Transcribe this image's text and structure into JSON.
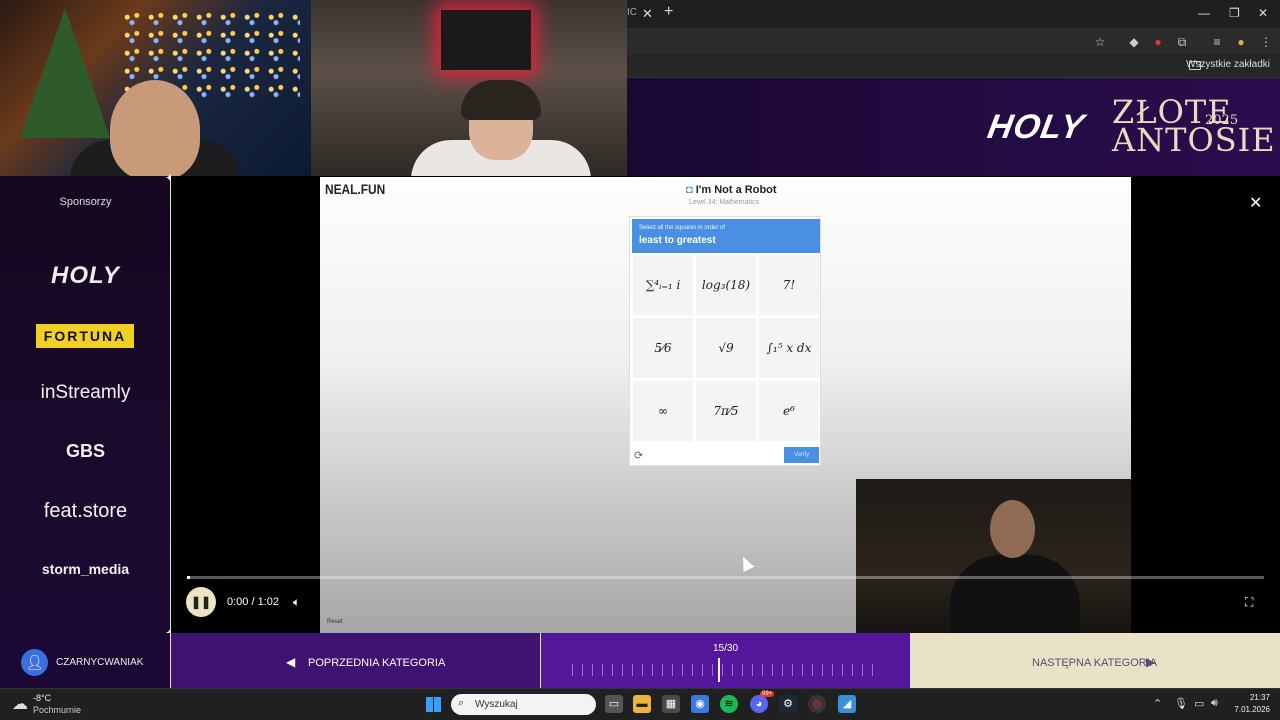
{
  "browser": {
    "tab_fragment": "IC",
    "bookmarks_all": "Wszystkie zakładki"
  },
  "banner": {
    "brand": "HOLY",
    "event_line1": "ZŁOTE",
    "event_line2": "ANTOSIE",
    "year": "2025"
  },
  "sidebar": {
    "title": "Sponsorzy",
    "sponsors": [
      "HOLY",
      "FORTUNA",
      "inStreamly",
      "GBS",
      "feat.store",
      "storm_media"
    ]
  },
  "game": {
    "site": "NEAL.FUN",
    "title": "I'm Not a Robot",
    "level": "Level 34: Mathematics",
    "instruction_small": "Select all the squares in order of",
    "instruction_big": "least to greatest",
    "cells": [
      "∑⁴ᵢ₌₁ i",
      "log₃(18)",
      "7!",
      "5⁄6",
      "√9",
      "∫₁⁵ x dx",
      "∞",
      "7π⁄5",
      "e⁶"
    ],
    "verify": "Verify",
    "reset": "Reset"
  },
  "player": {
    "time": "0:00 / 1:02",
    "progress": 0.002
  },
  "bottom": {
    "username": "CZARNYCWANIAK",
    "prev": "POPRZEDNIA KATEGORIA",
    "counter": "15/30",
    "next": "NASTĘPNA KATEGORIA"
  },
  "taskbar": {
    "temp": "-8°C",
    "condition": "Pochmurnie",
    "search_placeholder": "Wyszukaj",
    "time": "21:37",
    "date": "7.01.2026",
    "badge": "99+"
  }
}
